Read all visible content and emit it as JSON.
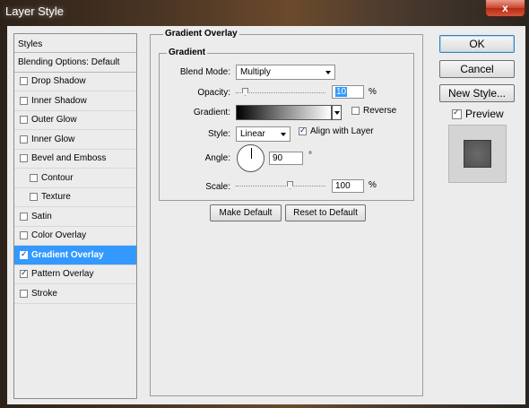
{
  "window": {
    "title": "Layer Style",
    "close_glyph": "x"
  },
  "styles_list": {
    "header": "Styles",
    "blending_options": "Blending Options: Default",
    "items": [
      {
        "label": "Drop Shadow",
        "checked": false,
        "sub": false
      },
      {
        "label": "Inner Shadow",
        "checked": false,
        "sub": false
      },
      {
        "label": "Outer Glow",
        "checked": false,
        "sub": false
      },
      {
        "label": "Inner Glow",
        "checked": false,
        "sub": false
      },
      {
        "label": "Bevel and Emboss",
        "checked": false,
        "sub": false
      },
      {
        "label": "Contour",
        "checked": false,
        "sub": true
      },
      {
        "label": "Texture",
        "checked": false,
        "sub": true
      },
      {
        "label": "Satin",
        "checked": false,
        "sub": false
      },
      {
        "label": "Color Overlay",
        "checked": false,
        "sub": false
      },
      {
        "label": "Gradient Overlay",
        "checked": true,
        "sub": false,
        "selected": true
      },
      {
        "label": "Pattern Overlay",
        "checked": true,
        "sub": false
      },
      {
        "label": "Stroke",
        "checked": false,
        "sub": false
      }
    ]
  },
  "panel": {
    "title": "Gradient Overlay",
    "group_title": "Gradient",
    "blend_mode": {
      "label": "Blend Mode:",
      "value": "Multiply"
    },
    "opacity": {
      "label": "Opacity:",
      "value": "10",
      "unit": "%",
      "level": 0.1
    },
    "gradient": {
      "label": "Gradient:",
      "reverse_label": "Reverse",
      "reverse_checked": false
    },
    "style": {
      "label": "Style:",
      "value": "Linear",
      "align_label": "Align with Layer",
      "align_checked": true
    },
    "angle": {
      "label": "Angle:",
      "value": "90",
      "unit": "°"
    },
    "scale": {
      "label": "Scale:",
      "value": "100",
      "unit": "%",
      "level": 0.6
    },
    "make_default": "Make Default",
    "reset_default": "Reset to Default"
  },
  "actions": {
    "ok": "OK",
    "cancel": "Cancel",
    "new_style": "New Style...",
    "preview_label": "Preview",
    "preview_checked": true
  }
}
